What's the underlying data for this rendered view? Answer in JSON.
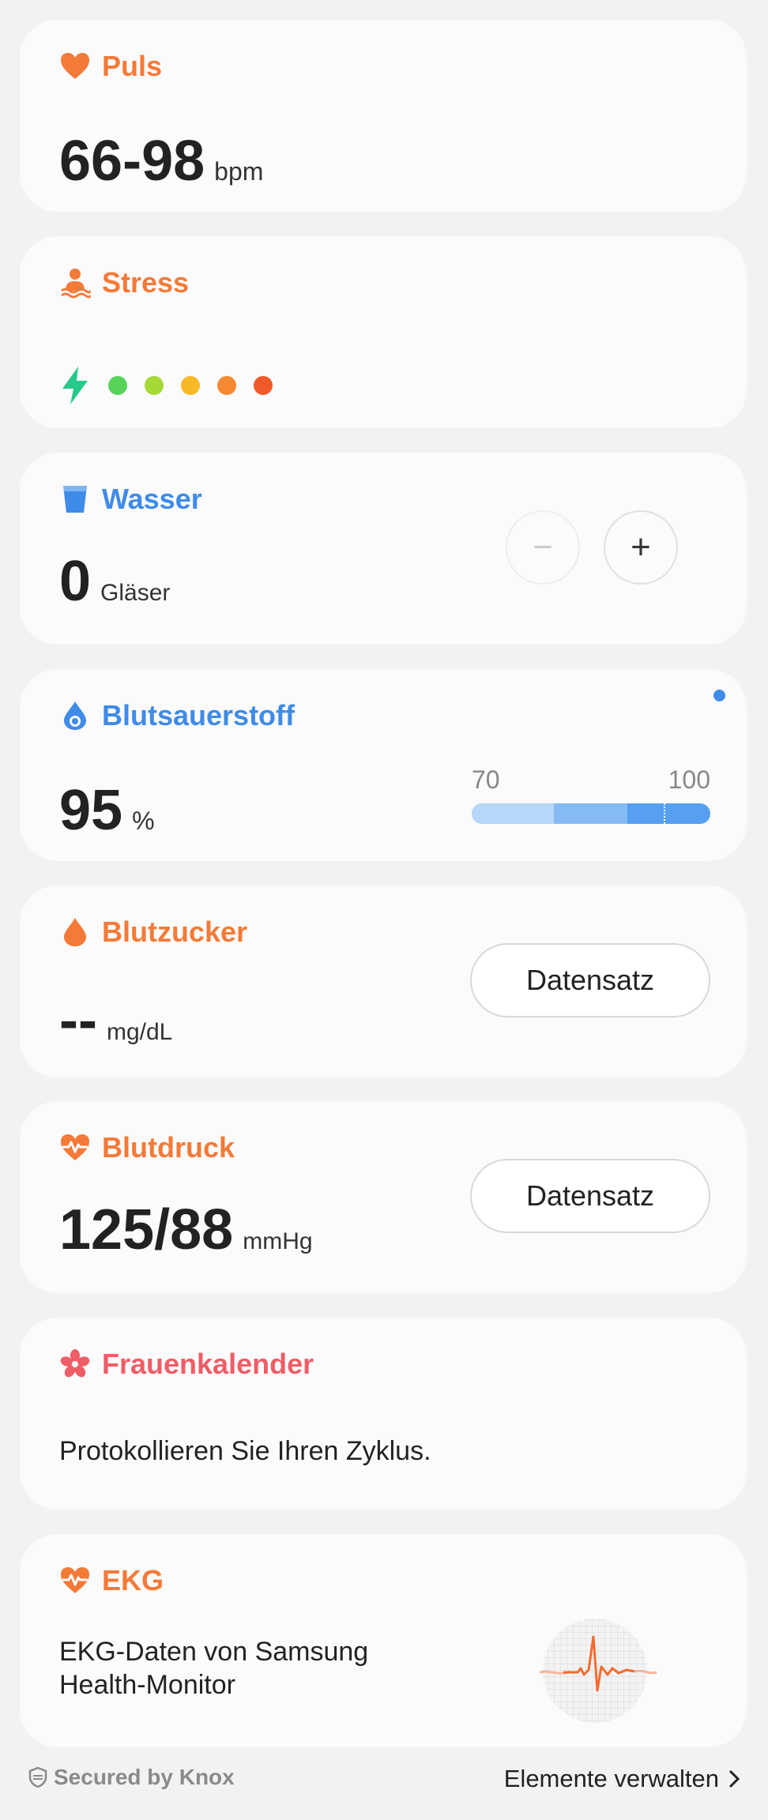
{
  "puls": {
    "title": "Puls",
    "value": "66-98",
    "unit": "bpm",
    "icon": "heart-icon"
  },
  "stress": {
    "title": "Stress",
    "icon": "person-stress-icon",
    "levels": [
      "#27c98a",
      "#57d35a",
      "#a7d936",
      "#f7b928",
      "#f58a33",
      "#f05a2a"
    ]
  },
  "wasser": {
    "title": "Wasser",
    "value": "0",
    "unit": "Gläser",
    "minus_label": "−",
    "plus_label": "+",
    "icon": "water-glass-icon"
  },
  "blutsauerstoff": {
    "title": "Blutsauerstoff",
    "value": "95",
    "unit": "%",
    "range_low": "70",
    "range_high": "100",
    "icon": "oxygen-drop-icon",
    "notification_color": "#3f8be8"
  },
  "blutzucker": {
    "title": "Blutzucker",
    "value": "--",
    "unit": "mg/dL",
    "button": "Datensatz",
    "icon": "drop-icon"
  },
  "blutdruck": {
    "title": "Blutdruck",
    "value": "125/88",
    "unit": "mmHg",
    "button": "Datensatz",
    "icon": "heart-pulse-icon"
  },
  "frauenkalender": {
    "title": "Frauenkalender",
    "text": "Protokollieren Sie Ihren Zyklus.",
    "icon": "flower-icon"
  },
  "ekg": {
    "title": "EKG",
    "line1": "EKG-Daten von Samsung",
    "line2": "Health-Monitor",
    "icon": "heart-pulse-icon"
  },
  "footer": {
    "secured": "Secured by Knox",
    "manage": "Elemente verwalten"
  },
  "colors": {
    "orange": "#f47a38",
    "blue": "#3f8be8",
    "pink": "#ef5d66",
    "background": "#f2f2f2",
    "card": "#fbfbfb"
  }
}
